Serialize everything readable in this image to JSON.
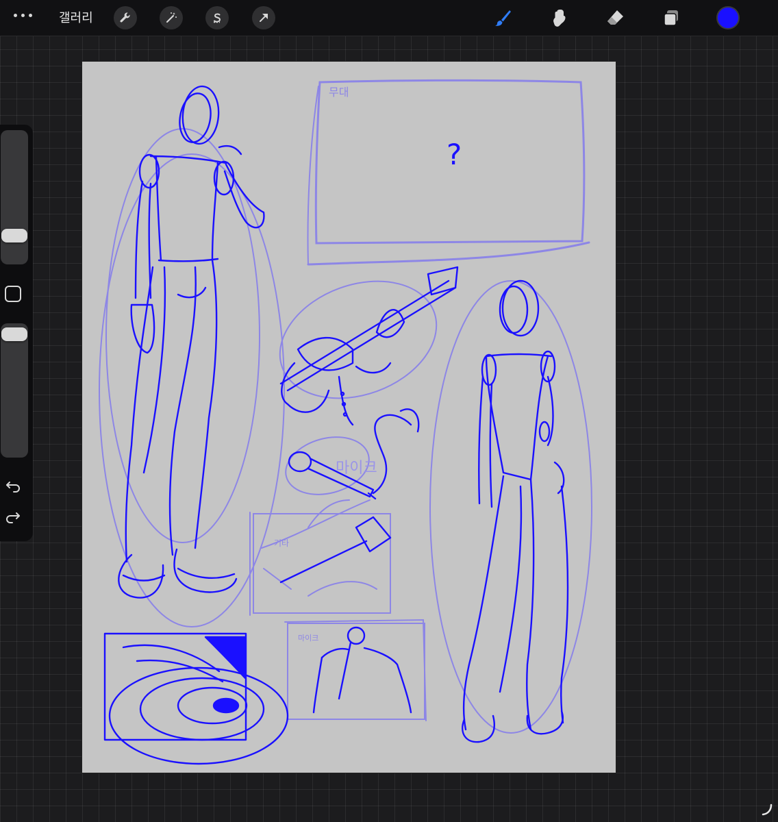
{
  "app": {
    "gallery_label": "갤러리"
  },
  "toolbar": {
    "left_tools": [
      "wrench-icon",
      "magic-wand-icon",
      "selection-s-icon",
      "transform-arrow-icon"
    ],
    "right_tools": [
      "brush-icon",
      "smudge-icon",
      "eraser-icon",
      "layers-icon"
    ],
    "active_tool": "brush",
    "current_color": "#1a10ff",
    "icon_color": "#d8d8d8",
    "active_icon_color": "#2f7cf6"
  },
  "sidebar": {
    "brush_size_slider": "slider",
    "modify_button": "square-icon",
    "opacity_slider": "slider",
    "undo": "undo-icon",
    "redo": "redo-icon"
  },
  "canvas": {
    "background": "#c5c5c5",
    "ink_color": "#1a10ff",
    "rough_color": "#8d86e6",
    "texts": {
      "stage_label": "무대",
      "question_mark": "?",
      "guitar_label": "기타",
      "mic_label": "마이크",
      "mic_oval_label": "마이크"
    }
  }
}
